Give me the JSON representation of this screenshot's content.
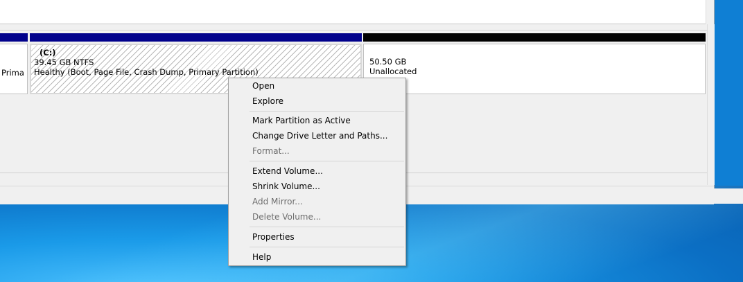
{
  "disk": {
    "system_partition": {
      "label_partial": "Prima"
    },
    "c_partition": {
      "name": "(C:)",
      "size": "39.45 GB NTFS",
      "status": "Healthy (Boot, Page File, Crash Dump, Primary Partition)"
    },
    "unallocated": {
      "size": "50.50 GB",
      "status": "Unallocated"
    }
  },
  "context_menu": {
    "items": [
      {
        "label": "Open",
        "enabled": true
      },
      {
        "label": "Explore",
        "enabled": true
      },
      {
        "label": "Mark Partition as Active",
        "enabled": true
      },
      {
        "label": "Change Drive Letter and Paths...",
        "enabled": true
      },
      {
        "label": "Format...",
        "enabled": false
      },
      {
        "label": "Extend Volume...",
        "enabled": true
      },
      {
        "label": "Shrink Volume...",
        "enabled": true
      },
      {
        "label": "Add Mirror...",
        "enabled": false
      },
      {
        "label": "Delete Volume...",
        "enabled": false
      },
      {
        "label": "Properties",
        "enabled": true
      },
      {
        "label": "Help",
        "enabled": true
      }
    ]
  },
  "colors": {
    "primary_partition_bar": "#00008b",
    "unallocated_bar": "#000000",
    "desktop_blue": "#0f7fd4"
  }
}
